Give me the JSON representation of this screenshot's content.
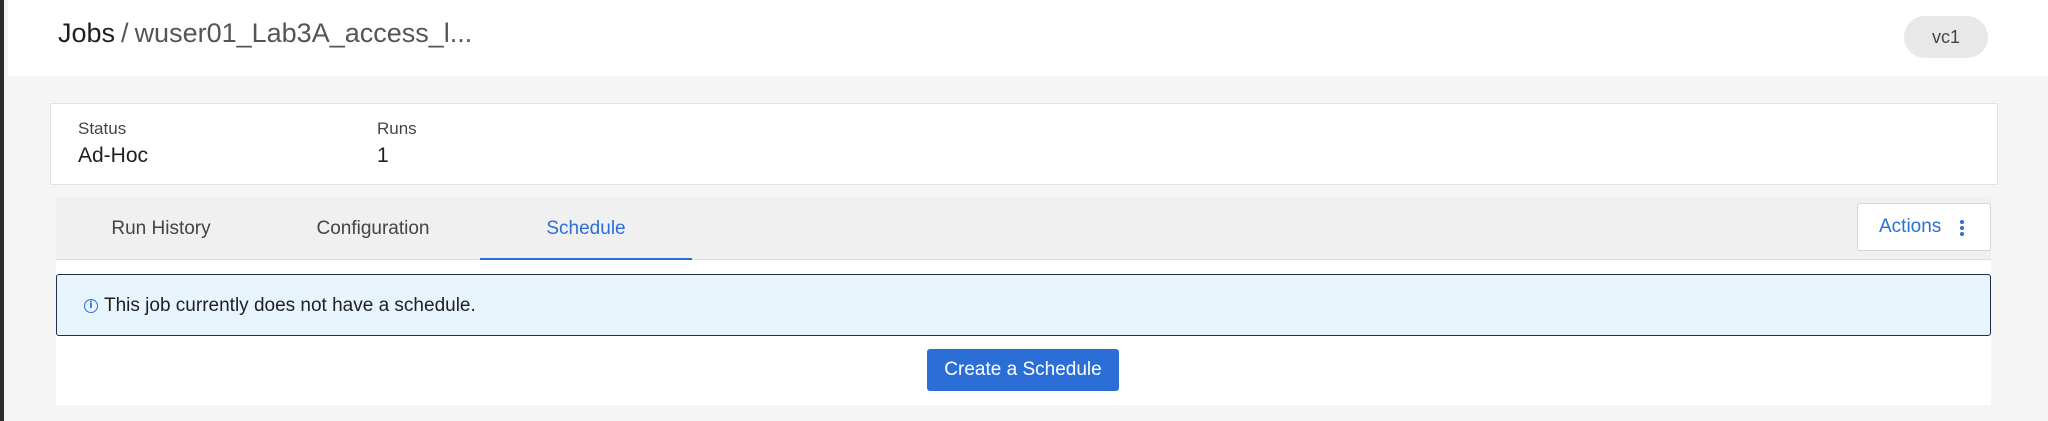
{
  "header": {
    "breadcrumb_root": "Jobs",
    "breadcrumb_separator": "/",
    "breadcrumb_current": "wuser01_Lab3A_access_l...",
    "cluster_chip": "vc1"
  },
  "summary": {
    "status_label": "Status",
    "status_value": "Ad-Hoc",
    "runs_label": "Runs",
    "runs_value": "1"
  },
  "tabs": [
    {
      "label": "Run History",
      "active": false
    },
    {
      "label": "Configuration",
      "active": false
    },
    {
      "label": "Schedule",
      "active": true
    }
  ],
  "actions": {
    "label": "Actions",
    "icon": "kebab-vertical-icon"
  },
  "schedule": {
    "info_icon": "info-circle-icon",
    "message": "This job currently does not have a schedule.",
    "create_label": "Create a Schedule"
  },
  "colors": {
    "accent": "#2b6fd6",
    "alert_bg": "#e8f4fc",
    "alert_border": "#1f2f4a"
  }
}
